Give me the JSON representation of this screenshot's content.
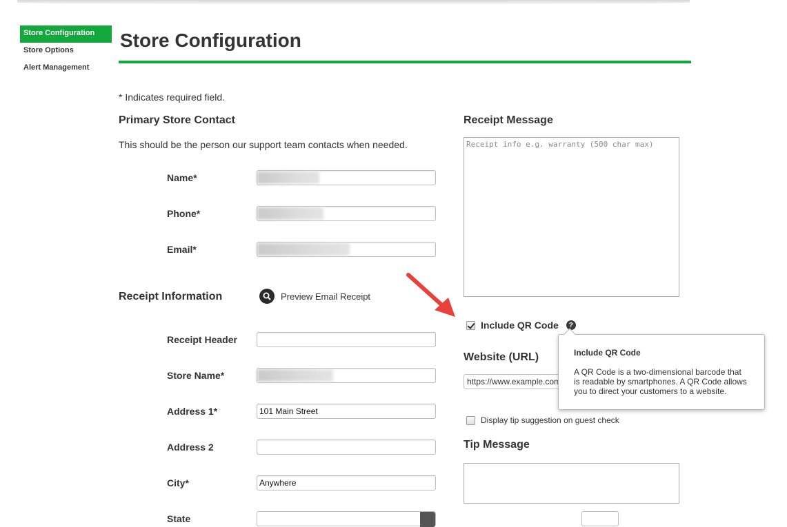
{
  "sidebar": {
    "items": [
      {
        "label": "Store Configuration",
        "active": true
      },
      {
        "label": "Store Options",
        "active": false
      },
      {
        "label": "Alert Management",
        "active": false
      }
    ]
  },
  "page": {
    "title": "Store Configuration",
    "required_note": "* Indicates required field."
  },
  "primary_contact": {
    "heading": "Primary Store Contact",
    "description": "This should be the person our support team contacts when needed.",
    "name_label": "Name*",
    "phone_label": "Phone*",
    "email_label": "Email*"
  },
  "receipt_info": {
    "heading": "Receipt Information",
    "preview_label": "Preview Email Receipt",
    "header_label": "Receipt Header",
    "header_value": "",
    "store_name_label": "Store Name*",
    "address1_label": "Address 1*",
    "address1_value": "101 Main Street",
    "address2_label": "Address 2",
    "address2_value": "",
    "city_label": "City*",
    "city_value": "Anywhere",
    "state_label": "State"
  },
  "receipt_message": {
    "heading": "Receipt Message",
    "placeholder": "Receipt info e.g. warranty (500 char max)"
  },
  "qr": {
    "label": "Include QR Code",
    "checked": true,
    "help_glyph": "?"
  },
  "tooltip": {
    "title": "Include QR Code",
    "body": "A QR Code is a two-dimensional barcode that is readable by smartphones. A QR Code allows you to direct your customers to a website."
  },
  "website": {
    "heading": "Website (URL)",
    "value": "https://www.example.com"
  },
  "tip": {
    "checkbox_label": "Display tip suggestion on guest check",
    "checked": false,
    "heading": "Tip Message"
  },
  "colors": {
    "accent": "#12a83c",
    "arrow": "#e8413c"
  }
}
